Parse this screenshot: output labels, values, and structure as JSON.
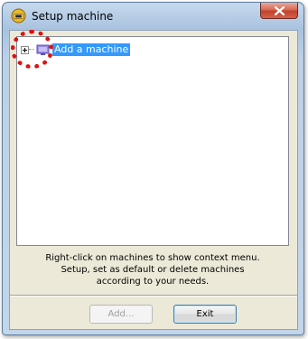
{
  "window": {
    "title": "Setup machine"
  },
  "tree": {
    "nodes": [
      {
        "label": "Add a machine",
        "expanded": false,
        "selected": true
      }
    ]
  },
  "hint": {
    "lines": [
      "Right-click on machines to show context menu.",
      "Setup, set as default or delete machines",
      "according to your needs."
    ]
  },
  "buttons": {
    "add_label": "Add...",
    "add_enabled": false,
    "exit_label": "Exit"
  },
  "colors": {
    "selection": "#3399ff",
    "close_button": "#c1412b",
    "annotation": "#e01010"
  },
  "icons": {
    "title": "app-icon",
    "close": "close-icon",
    "node": "machine-icon",
    "expander": "plus-expander-icon"
  }
}
